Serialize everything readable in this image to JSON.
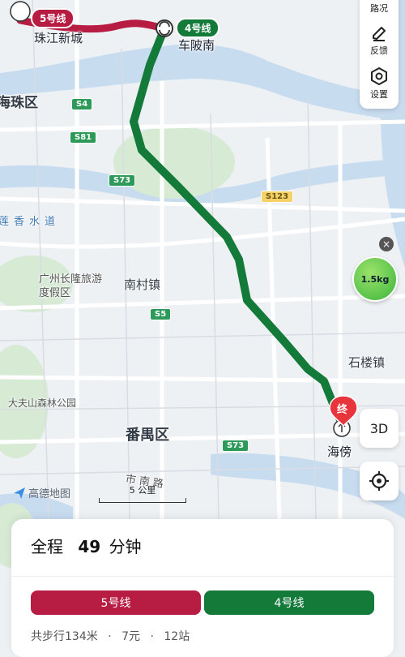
{
  "map": {
    "districts": {
      "haizhu": "海珠区",
      "panyu": "番禺区"
    },
    "towns": {
      "nancun": "南村镇",
      "shilou": "石楼镇"
    },
    "roads": {
      "lianxiang": "莲香水道",
      "shinan": "市南路"
    },
    "places": {
      "changlong": "广州长隆旅游度假区",
      "dafushan": "大夫山森林公园"
    },
    "road_badges": {
      "s4": "S4",
      "s81": "S81",
      "s73a": "S73",
      "s123": "S123",
      "s5": "S5",
      "s73b": "S73"
    },
    "colors": {
      "line5": "#b71c43",
      "line4": "#137a39",
      "water": "#c8dcf0",
      "green": "#d6ead4"
    }
  },
  "route": {
    "line5_tag": "5号线",
    "line4_tag": "4号线",
    "start_station": "珠江新城",
    "transfer_station": "车陂南",
    "end_station": "海傍",
    "end_marker": "终"
  },
  "toolbar": {
    "traffic_label": "路况",
    "feedback_label": "反馈",
    "settings_label": "设置"
  },
  "carbon_badge": "1.5kg",
  "view_3d": "3D",
  "scale_label": "5 公里",
  "logo_text": "高德地图",
  "summary": {
    "prefix": "全程",
    "duration": "49",
    "unit": "分钟",
    "segments": [
      {
        "name": "5号线",
        "color": "#b71c43"
      },
      {
        "name": "4号线",
        "color": "#137a39"
      }
    ],
    "walk": "共步行134米",
    "price": "7元",
    "stops": "12站"
  }
}
